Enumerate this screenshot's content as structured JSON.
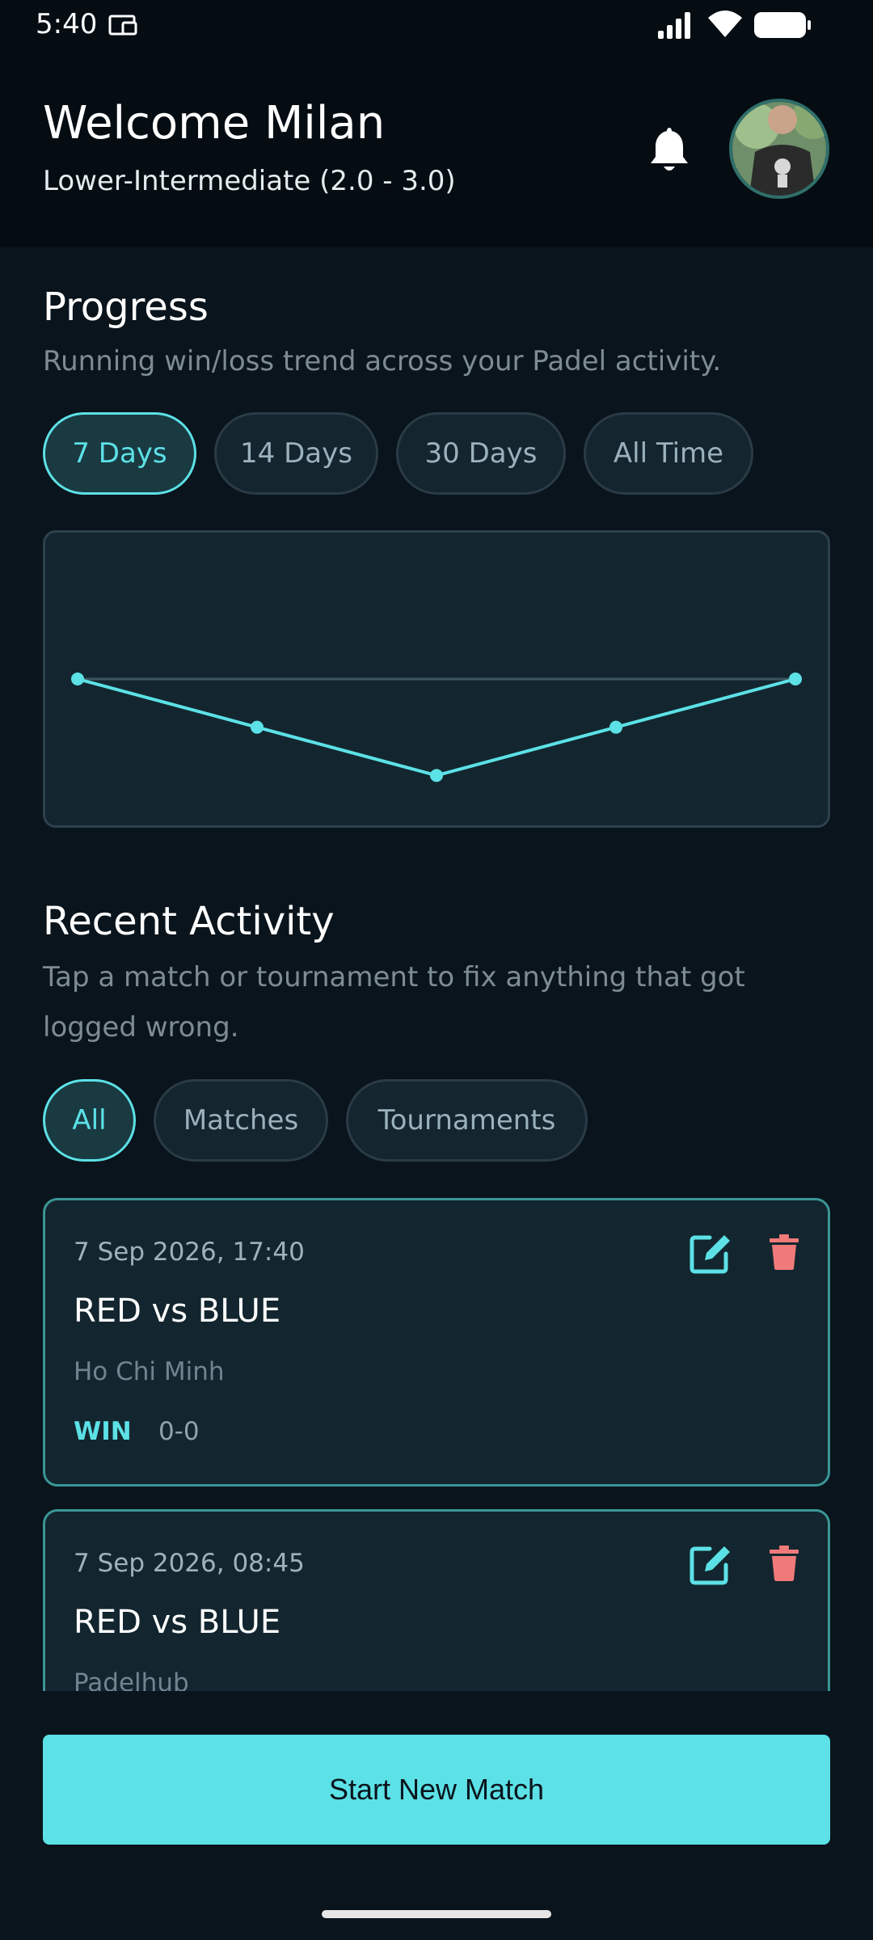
{
  "status_bar": {
    "time": "5:40"
  },
  "header": {
    "welcome": "Welcome Milan",
    "level": "Lower-Intermediate (2.0 - 3.0)"
  },
  "progress": {
    "title": "Progress",
    "subtitle": "Running win/loss trend across your Padel activity.",
    "filters": [
      "7 Days",
      "14 Days",
      "30 Days",
      "All Time"
    ],
    "selected_filter": "7 Days"
  },
  "chart_data": {
    "type": "line",
    "title": "",
    "xlabel": "",
    "ylabel": "",
    "x": [
      1,
      2,
      3,
      4,
      5
    ],
    "series": [
      {
        "values": [
          0,
          -1,
          -2,
          -1,
          0
        ]
      }
    ],
    "ylim": [
      -3,
      3
    ],
    "baseline": 0,
    "grid": false,
    "line_color": "#5ce1e6"
  },
  "recent_activity": {
    "title": "Recent Activity",
    "subtitle": "Tap a match or tournament to fix anything that got logged wrong.",
    "filters": [
      "All",
      "Matches",
      "Tournaments"
    ],
    "selected_filter": "All",
    "items": [
      {
        "date": "7 Sep 2026, 17:40",
        "title": "RED vs BLUE",
        "place": "Ho Chi Minh",
        "result": "WIN",
        "score": "0-0"
      },
      {
        "date": "7 Sep 2026, 08:45",
        "title": "RED vs BLUE",
        "place": "Padelhub",
        "result": "",
        "score": ""
      }
    ]
  },
  "actions": {
    "start_new_match": "Start New Match"
  },
  "colors": {
    "accent": "#5ce1e6",
    "background": "#0a141c",
    "card": "#13262f",
    "delete": "#f07a7a"
  }
}
